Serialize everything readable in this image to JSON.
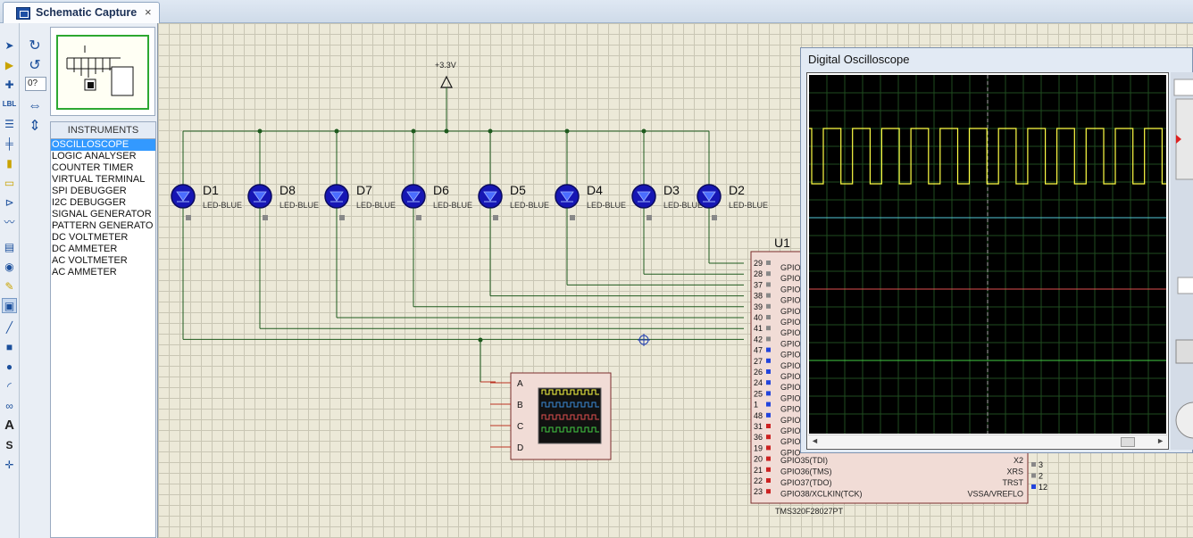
{
  "tab": {
    "title": "Schematic Capture",
    "close": "×"
  },
  "sidepanel": {
    "rotation_value": "0?",
    "instruments_header": "INSTRUMENTS",
    "instruments": [
      "OSCILLOSCOPE",
      "LOGIC ANALYSER",
      "COUNTER TIMER",
      "VIRTUAL TERMINAL",
      "SPI DEBUGGER",
      "I2C DEBUGGER",
      "SIGNAL GENERATOR",
      "PATTERN GENERATO",
      "DC VOLTMETER",
      "DC AMMETER",
      "AC VOLTMETER",
      "AC AMMETER"
    ],
    "selected_instrument": "OSCILLOSCOPE"
  },
  "toolbar": {
    "icons": [
      "select-arrow-icon",
      "component-icon",
      "junction-icon",
      "wire-label-icon",
      "text-script-icon",
      "bus-icon",
      "subcircuit-icon",
      "terminal-icon",
      "pin-icon",
      "graph-icon",
      "tape-recorder-icon",
      "generator-icon",
      "probe-icon",
      "instrument-icon",
      "line-icon",
      "box-icon",
      "circle-icon",
      "arc-icon",
      "path-icon",
      "text-icon",
      "symbol-icon",
      "marker-icon"
    ]
  },
  "schematic": {
    "power_label": "+3.3V",
    "leds": [
      {
        "ref": "D1",
        "value": "LED-BLUE"
      },
      {
        "ref": "D8",
        "value": "LED-BLUE"
      },
      {
        "ref": "D7",
        "value": "LED-BLUE"
      },
      {
        "ref": "D6",
        "value": "LED-BLUE"
      },
      {
        "ref": "D5",
        "value": "LED-BLUE"
      },
      {
        "ref": "D4",
        "value": "LED-BLUE"
      },
      {
        "ref": "D3",
        "value": "LED-BLUE"
      },
      {
        "ref": "D2",
        "value": "LED-BLUE"
      }
    ],
    "chip": {
      "ref": "U1",
      "part": "TMS320F28027PT",
      "left_pins": [
        "29",
        "28",
        "37",
        "38",
        "39",
        "40",
        "41",
        "42",
        "47",
        "27",
        "26",
        "24",
        "25",
        "1",
        "48",
        "31",
        "36",
        "19",
        "20",
        "21",
        "22",
        "23"
      ],
      "gpio_label": "GPIO",
      "bottom_left_labels": [
        "GPIO35(TDI)",
        "GPIO36(TMS)",
        "GPIO37(TDO)",
        "GPIO38/XCLKIN(TCK)"
      ],
      "right_labels": [
        "X2",
        "XRS",
        "TRST",
        "VSSA/VREFLO"
      ],
      "right_pins": [
        "3",
        "2",
        "12"
      ]
    },
    "scope_inputs": [
      "A",
      "B",
      "C",
      "D"
    ]
  },
  "oscilloscope": {
    "title": "Digital Oscilloscope",
    "colors": {
      "channel_a": "#ffff44",
      "channel_b": "#55c8d8",
      "channel_c": "#e05050",
      "channel_d": "#44cc44"
    },
    "channel_a_wave": "square",
    "scroll_left": "◄",
    "scroll_right": "►"
  }
}
